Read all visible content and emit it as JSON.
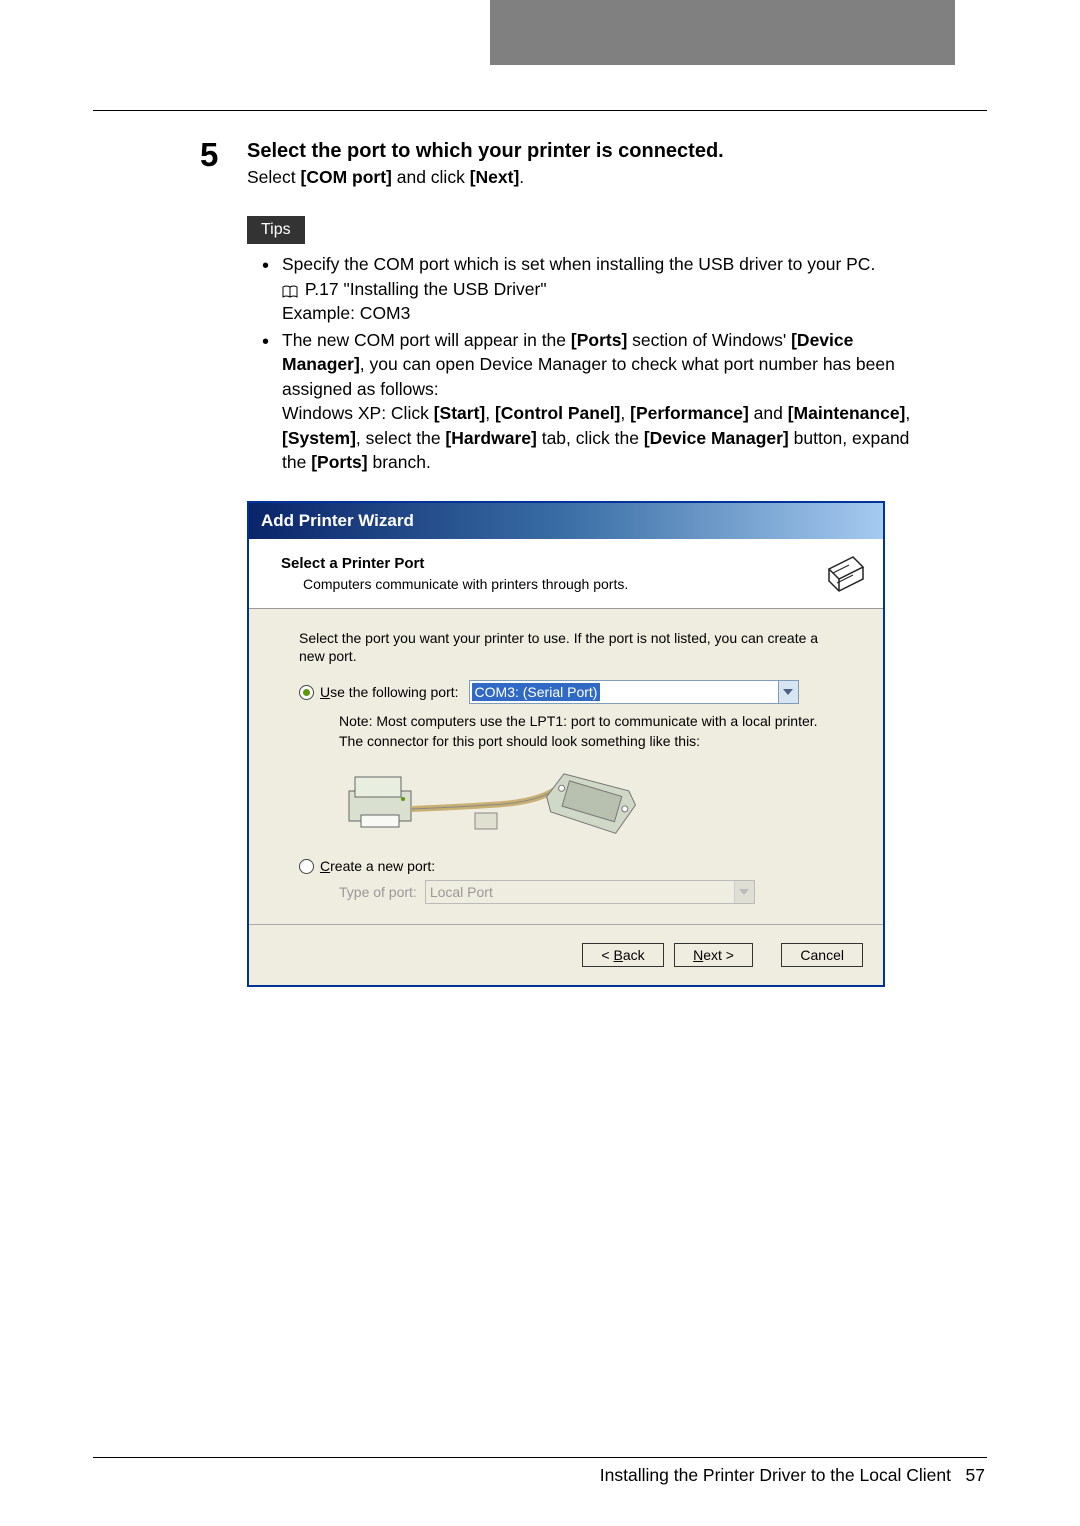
{
  "step": {
    "number": "5",
    "heading": "Select the port to which your printer is connected.",
    "subtext_prefix": "Select ",
    "subtext_bold1": "[COM port]",
    "subtext_mid": " and click ",
    "subtext_bold2": "[Next]",
    "subtext_suffix": "."
  },
  "tips": {
    "label": "Tips",
    "items": [
      {
        "line1": "Specify the COM port which is set when installing the USB driver to your PC.",
        "line2_ref": "P.17 \"Installing the USB Driver\"",
        "line3": "Example: COM3"
      },
      {
        "line1a": "The new COM port will appear in the ",
        "line1b": "[Ports]",
        "line1c": " section of Windows' ",
        "line1d": "[Device Manager]",
        "line1e": ", you can open Device Manager to check what port number has been assigned as follows:",
        "line2a": "Windows XP: Click ",
        "line2b": "[Start]",
        "line2c": ", ",
        "line2d": "[Control Panel]",
        "line2e": ", ",
        "line2f": "[Performance]",
        "line2g": " and ",
        "line2h": "[Maintenance]",
        "line2i": ", ",
        "line2j": "[System]",
        "line2k": ", select the ",
        "line2l": "[Hardware]",
        "line2m": " tab, click the ",
        "line2n": "[Device Manager]",
        "line2o": " button, expand the ",
        "line2p": "[Ports]",
        "line2q": " branch."
      }
    ]
  },
  "wizard": {
    "title": "Add Printer Wizard",
    "header_title": "Select a Printer Port",
    "header_sub": "Computers communicate with printers through ports.",
    "body_intro": "Select the port you want your printer to use.  If the port is not listed, you can create a new port.",
    "radio_use_prefix": "U",
    "radio_use_suffix": "se the following port:",
    "port_selected": "COM3: (Serial Port)",
    "note_line1": "Note: Most computers use the LPT1: port to communicate with a local printer.",
    "note_line2": "The connector for this port should look something like this:",
    "radio_create_prefix": "C",
    "radio_create_suffix": "reate a new port:",
    "type_of_port_label": "Type of port:",
    "type_of_port_value": "Local Port",
    "back_u": "B",
    "back_rest": "ack",
    "back_prefix": "< ",
    "next_u": "N",
    "next_rest": "ext >",
    "cancel": "Cancel"
  },
  "footer": {
    "text": "Installing the Printer Driver to the Local Client",
    "page": "57"
  }
}
